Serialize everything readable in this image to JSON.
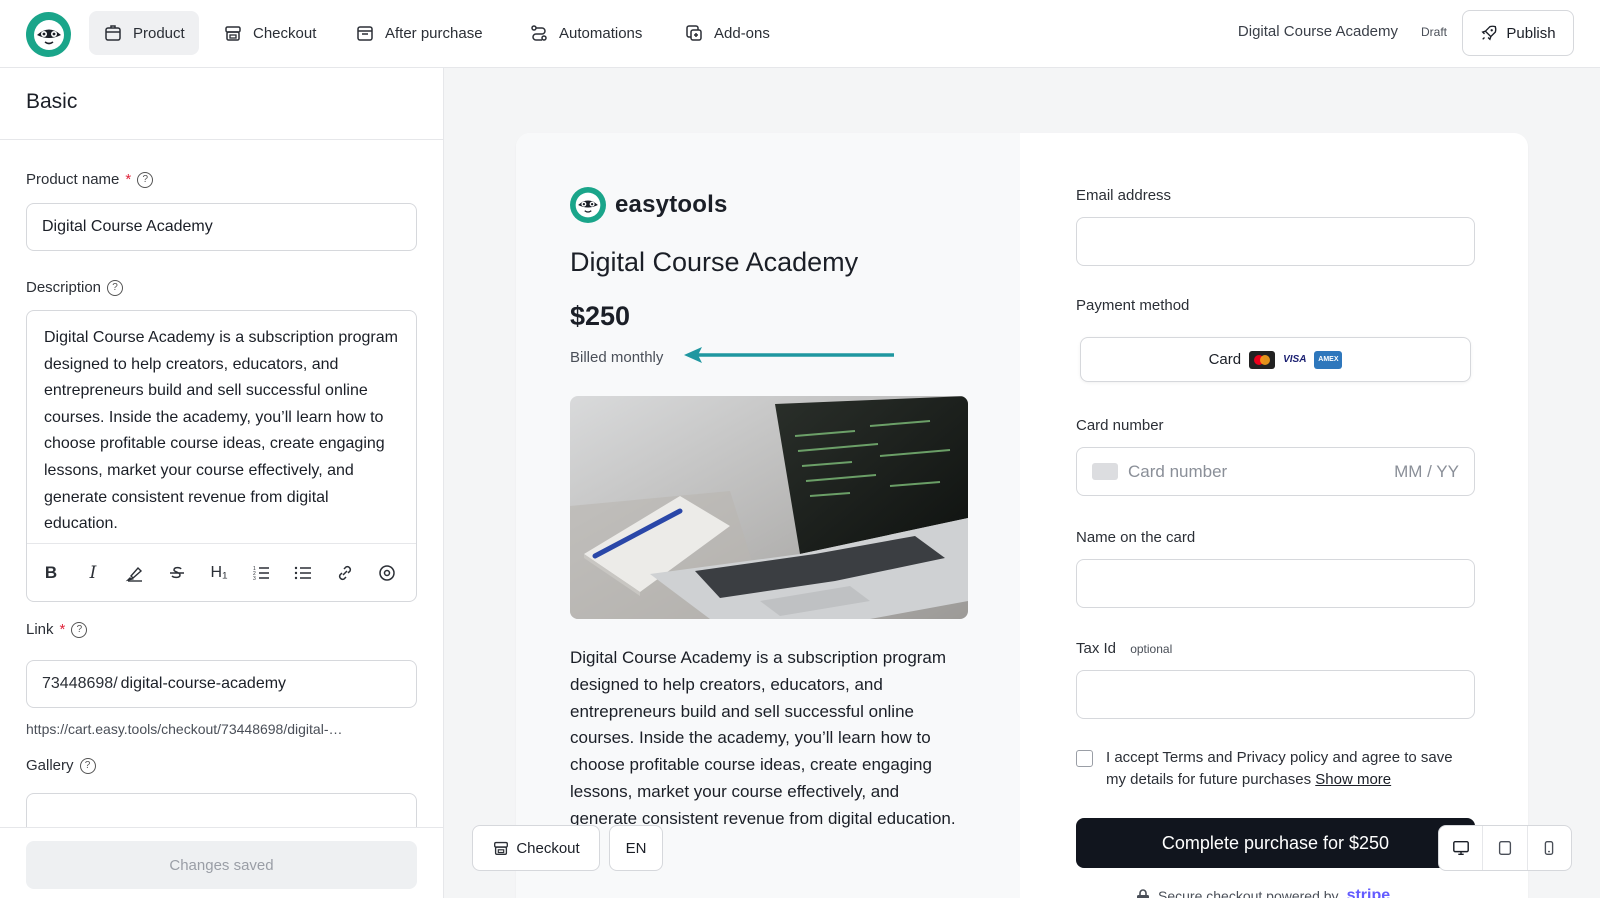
{
  "nav": {
    "tabs": [
      {
        "label": "Product"
      },
      {
        "label": "Checkout"
      },
      {
        "label": "After purchase"
      },
      {
        "label": "Automations"
      },
      {
        "label": "Add-ons"
      }
    ],
    "product_title": "Digital Course Academy",
    "status_badge": "Draft",
    "publish_label": "Publish"
  },
  "editor": {
    "section_title": "Basic",
    "product_name_label": "Product name",
    "required_mark": "*",
    "product_name_value": "Digital Course Academy",
    "description_label": "Description",
    "description_value": "Digital Course Academy is a subscription program designed to help creators, educators, and entrepreneurs build and sell successful online courses. Inside the academy, you’ll learn how to choose profitable course ideas, create engaging lessons, market your course effectively, and generate consistent revenue from digital education.",
    "toolbar": {
      "bold": "B",
      "italic": "I",
      "heading": "H₁"
    },
    "link_label": "Link",
    "link_prefix": "73448698/",
    "link_slug": "digital-course-academy",
    "link_url": "https://cart.easy.tools/checkout/73448698/digital-…",
    "gallery_label": "Gallery",
    "save_status": "Changes saved"
  },
  "preview": {
    "brand_name": "easytools",
    "product_title": "Digital Course Academy",
    "price": "$250",
    "billing": "Billed monthly",
    "description": "Digital Course Academy is a subscription program designed to help creators, educators, and entrepreneurs build and sell successful online courses. Inside the academy, you’ll learn how to choose profitable course ideas, create engaging lessons, market your course effectively, and generate consistent revenue from digital education.",
    "email_label": "Email address",
    "payment_label": "Payment method",
    "payment_option": "Card",
    "visa": "VISA",
    "amex": "AMEX",
    "card_number_label": "Card number",
    "card_number_placeholder": "Card number",
    "expiry_placeholder": "MM / YY",
    "name_label": "Name on the card",
    "tax_label": "Tax Id",
    "tax_optional": "optional",
    "terms_text": "I accept Terms and Privacy policy and agree to save my details for future purchases",
    "show_more": "Show more",
    "cta": "Complete purchase for $250",
    "secure_text": "Secure checkout powered by",
    "stripe": "stripe"
  },
  "controls": {
    "checkout_label": "Checkout",
    "language": "EN"
  },
  "colors": {
    "brand_green": "#1aa58a",
    "cta_dark": "#11151e",
    "arrow_teal": "#1f97a0",
    "required_red": "#e0243b"
  }
}
